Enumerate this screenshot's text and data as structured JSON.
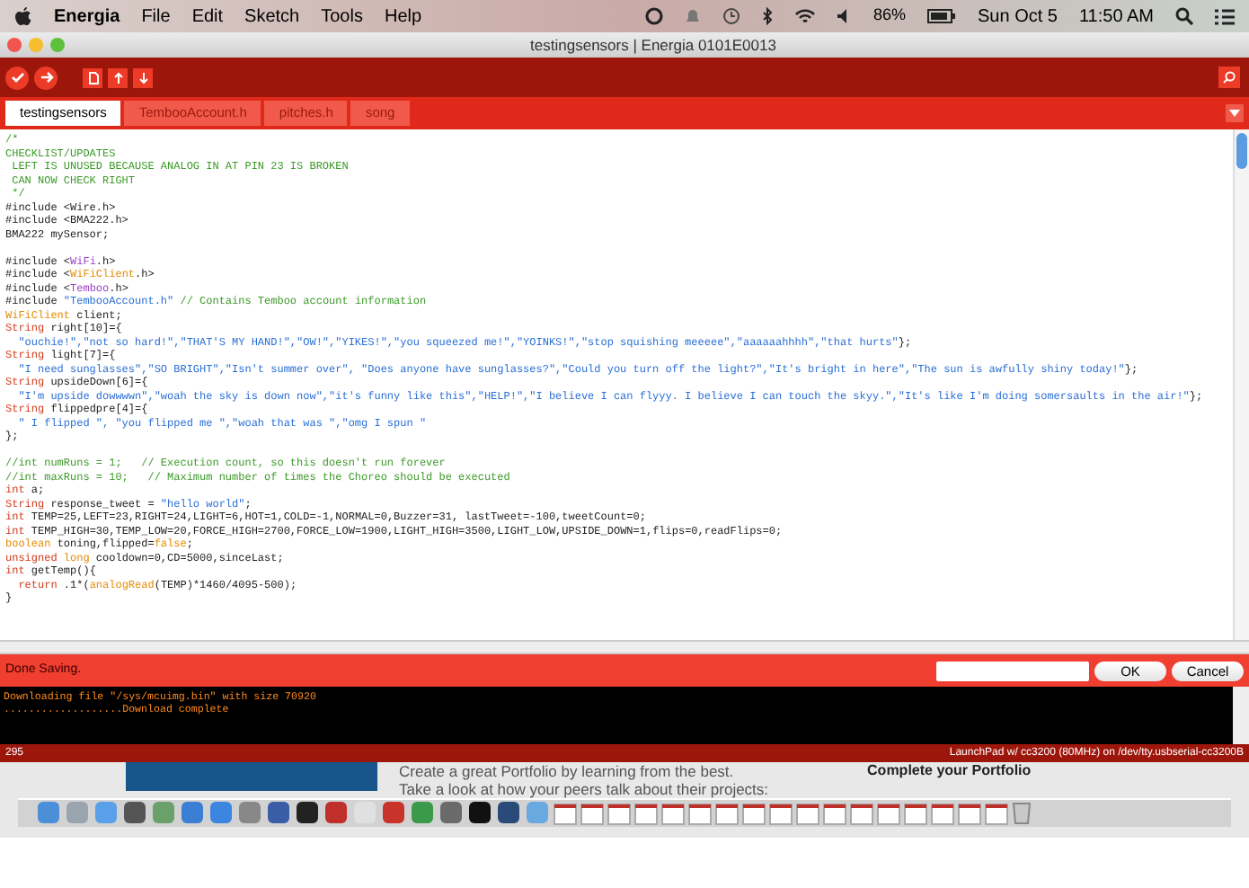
{
  "menu_bar": {
    "app_name": "Energia",
    "menus": [
      "File",
      "Edit",
      "Sketch",
      "Tools",
      "Help"
    ],
    "battery": "86%",
    "date": "Sun Oct 5",
    "time": "11:50 AM"
  },
  "window": {
    "title": "testingsensors | Energia 0101E0013"
  },
  "tabs": [
    {
      "label": "testingsensors",
      "selected": true
    },
    {
      "label": "TembooAccount.h",
      "selected": false
    },
    {
      "label": "pitches.h",
      "selected": false
    },
    {
      "label": "song",
      "selected": false
    }
  ],
  "editor": {
    "lines": [
      {
        "kind": "code",
        "tokens": [
          {
            "text": "/*",
            "kind": "comment"
          }
        ]
      },
      {
        "kind": "code",
        "tokens": [
          {
            "text": "CHECKLIST/UPDATES",
            "kind": "comment"
          }
        ]
      },
      {
        "kind": "code",
        "tokens": [
          {
            "text": " LEFT IS UNUSED BECAUSE ANALOG IN AT PIN 23 IS BROKEN",
            "kind": "comment"
          }
        ]
      },
      {
        "kind": "code",
        "tokens": [
          {
            "text": " CAN NOW CHECK RIGHT",
            "kind": "comment"
          }
        ]
      },
      {
        "kind": "code",
        "tokens": [
          {
            "text": " */",
            "kind": "comment"
          }
        ]
      },
      {
        "kind": "code",
        "tokens": [
          {
            "text": "#include <Wire.h>",
            "kind": "plain"
          }
        ]
      },
      {
        "kind": "code",
        "tokens": [
          {
            "text": "#include <BMA222.h>",
            "kind": "plain"
          }
        ]
      },
      {
        "kind": "code",
        "tokens": [
          {
            "text": "BMA222 mySensor;",
            "kind": "plain"
          }
        ]
      },
      {
        "kind": "blank"
      },
      {
        "kind": "code",
        "tokens": [
          {
            "text": "#include <",
            "kind": "plain"
          },
          {
            "text": "WiFi",
            "kind": "library"
          },
          {
            "text": ".h>",
            "kind": "plain"
          }
        ]
      },
      {
        "kind": "code",
        "tokens": [
          {
            "text": "#include <",
            "kind": "plain"
          },
          {
            "text": "WiFiClient",
            "kind": "class"
          },
          {
            "text": ".h>",
            "kind": "plain"
          }
        ]
      },
      {
        "kind": "code",
        "tokens": [
          {
            "text": "#include <",
            "kind": "plain"
          },
          {
            "text": "Temboo",
            "kind": "library"
          },
          {
            "text": ".h>",
            "kind": "plain"
          }
        ]
      },
      {
        "kind": "code",
        "tokens": [
          {
            "text": "#include ",
            "kind": "plain"
          },
          {
            "text": "\"TembooAccount.h\"",
            "kind": "string"
          },
          {
            "text": " // Contains Temboo account information",
            "kind": "comment"
          }
        ]
      },
      {
        "kind": "code",
        "tokens": [
          {
            "text": "WiFiClient",
            "kind": "class"
          },
          {
            "text": " client;",
            "kind": "plain"
          }
        ]
      },
      {
        "kind": "code",
        "tokens": [
          {
            "text": "String",
            "kind": "type"
          },
          {
            "text": " right[10]={",
            "kind": "plain"
          }
        ]
      },
      {
        "kind": "code",
        "tokens": [
          {
            "text": "  \"ouchie!\",\"not so hard!\",\"THAT'S MY HAND!\",\"OW!\",\"YIKES!\",\"you squeezed me!\",\"YOINKS!\",\"stop squishing meeeee\",\"aaaaaahhhh\",\"that hurts\"",
            "kind": "string"
          },
          {
            "text": "};",
            "kind": "plain"
          }
        ]
      },
      {
        "kind": "code",
        "tokens": [
          {
            "text": "String",
            "kind": "type"
          },
          {
            "text": " light[7]={",
            "kind": "plain"
          }
        ]
      },
      {
        "kind": "code",
        "tokens": [
          {
            "text": "  \"I need sunglasses\",\"SO BRIGHT\",\"Isn't summer over\", \"Does anyone have sunglasses?\",\"Could you turn off the light?\",\"It's bright in here\",\"The sun is awfully shiny today!\"",
            "kind": "string"
          },
          {
            "text": "};",
            "kind": "plain"
          }
        ]
      },
      {
        "kind": "code",
        "tokens": [
          {
            "text": "String",
            "kind": "type"
          },
          {
            "text": " upsideDown[6]={",
            "kind": "plain"
          }
        ]
      },
      {
        "kind": "code",
        "tokens": [
          {
            "text": "  \"I'm upside dowwwwn\",\"woah the sky is down now\",\"it's funny like this\",\"HELP!\",\"I believe I can flyyy. I believe I can touch the skyy.\",\"It's like I'm doing somersaults in the air!\"",
            "kind": "string"
          },
          {
            "text": "};",
            "kind": "plain"
          }
        ]
      },
      {
        "kind": "code",
        "tokens": [
          {
            "text": "String",
            "kind": "type"
          },
          {
            "text": " flippedpre[4]={",
            "kind": "plain"
          }
        ]
      },
      {
        "kind": "code",
        "tokens": [
          {
            "text": "  \" I flipped \", \"you flipped me \",\"woah that was \",\"omg I spun \"",
            "kind": "string"
          }
        ]
      },
      {
        "kind": "code",
        "tokens": [
          {
            "text": "};",
            "kind": "plain"
          }
        ]
      },
      {
        "kind": "blank"
      },
      {
        "kind": "code",
        "tokens": [
          {
            "text": "//int numRuns = 1;   // Execution count, so this doesn't run forever",
            "kind": "comment"
          }
        ]
      },
      {
        "kind": "code",
        "tokens": [
          {
            "text": "//int maxRuns = 10;   // Maximum number of times the Choreo should be executed",
            "kind": "comment"
          }
        ]
      },
      {
        "kind": "code",
        "tokens": [
          {
            "text": "int",
            "kind": "type"
          },
          {
            "text": " a;",
            "kind": "plain"
          }
        ]
      },
      {
        "kind": "code",
        "tokens": [
          {
            "text": "String",
            "kind": "type"
          },
          {
            "text": " response_tweet = ",
            "kind": "plain"
          },
          {
            "text": "\"hello world\"",
            "kind": "string"
          },
          {
            "text": ";",
            "kind": "plain"
          }
        ]
      },
      {
        "kind": "code",
        "tokens": [
          {
            "text": "int",
            "kind": "type"
          },
          {
            "text": " TEMP=25,LEFT=23,RIGHT=24,LIGHT=6,HOT=1,COLD=-1,NORMAL=0,Buzzer=31, lastTweet=-100,tweetCount=0;",
            "kind": "plain"
          }
        ]
      },
      {
        "kind": "code",
        "tokens": [
          {
            "text": "int",
            "kind": "type"
          },
          {
            "text": " TEMP_HIGH=30,TEMP_LOW=20,FORCE_HIGH=2700,FORCE_LOW=1900,LIGHT_HIGH=3500,LIGHT_LOW,UPSIDE_DOWN=1,flips=0,readFlips=0;",
            "kind": "plain"
          }
        ]
      },
      {
        "kind": "code",
        "tokens": [
          {
            "text": "boolean",
            "kind": "class"
          },
          {
            "text": " toning,flipped=",
            "kind": "plain"
          },
          {
            "text": "false",
            "kind": "class"
          },
          {
            "text": ";",
            "kind": "plain"
          }
        ]
      },
      {
        "kind": "code",
        "tokens": [
          {
            "text": "unsigned ",
            "kind": "type"
          },
          {
            "text": "long",
            "kind": "class"
          },
          {
            "text": " cooldown=0,CD=5000,sinceLast;",
            "kind": "plain"
          }
        ]
      },
      {
        "kind": "code",
        "tokens": [
          {
            "text": "int",
            "kind": "type"
          },
          {
            "text": " getTemp(){",
            "kind": "plain"
          }
        ]
      },
      {
        "kind": "code",
        "tokens": [
          {
            "text": "  return",
            "kind": "type"
          },
          {
            "text": " .1*(",
            "kind": "plain"
          },
          {
            "text": "analogRead",
            "kind": "class"
          },
          {
            "text": "(TEMP)*1460/4095-500);",
            "kind": "plain"
          }
        ]
      },
      {
        "kind": "code",
        "tokens": [
          {
            "text": "}",
            "kind": "plain"
          }
        ]
      }
    ]
  },
  "status": {
    "message": "Done Saving.",
    "buttons": [
      "OK",
      "Cancel"
    ]
  },
  "console": {
    "lines": [
      "Downloading file \"/sys/mcuimg.bin\" with size 70920",
      "...................Download complete"
    ]
  },
  "footer": {
    "line_number": "295",
    "board": "LaunchPad w/ cc3200 (80MHz) on /dev/tty.usbserial-cc3200B"
  },
  "background_page": {
    "heading": "Create a great Portfolio by learning from the best.",
    "subheading": "Take a look at how your peers talk about their projects:",
    "side_title": "Complete your Portfolio"
  }
}
